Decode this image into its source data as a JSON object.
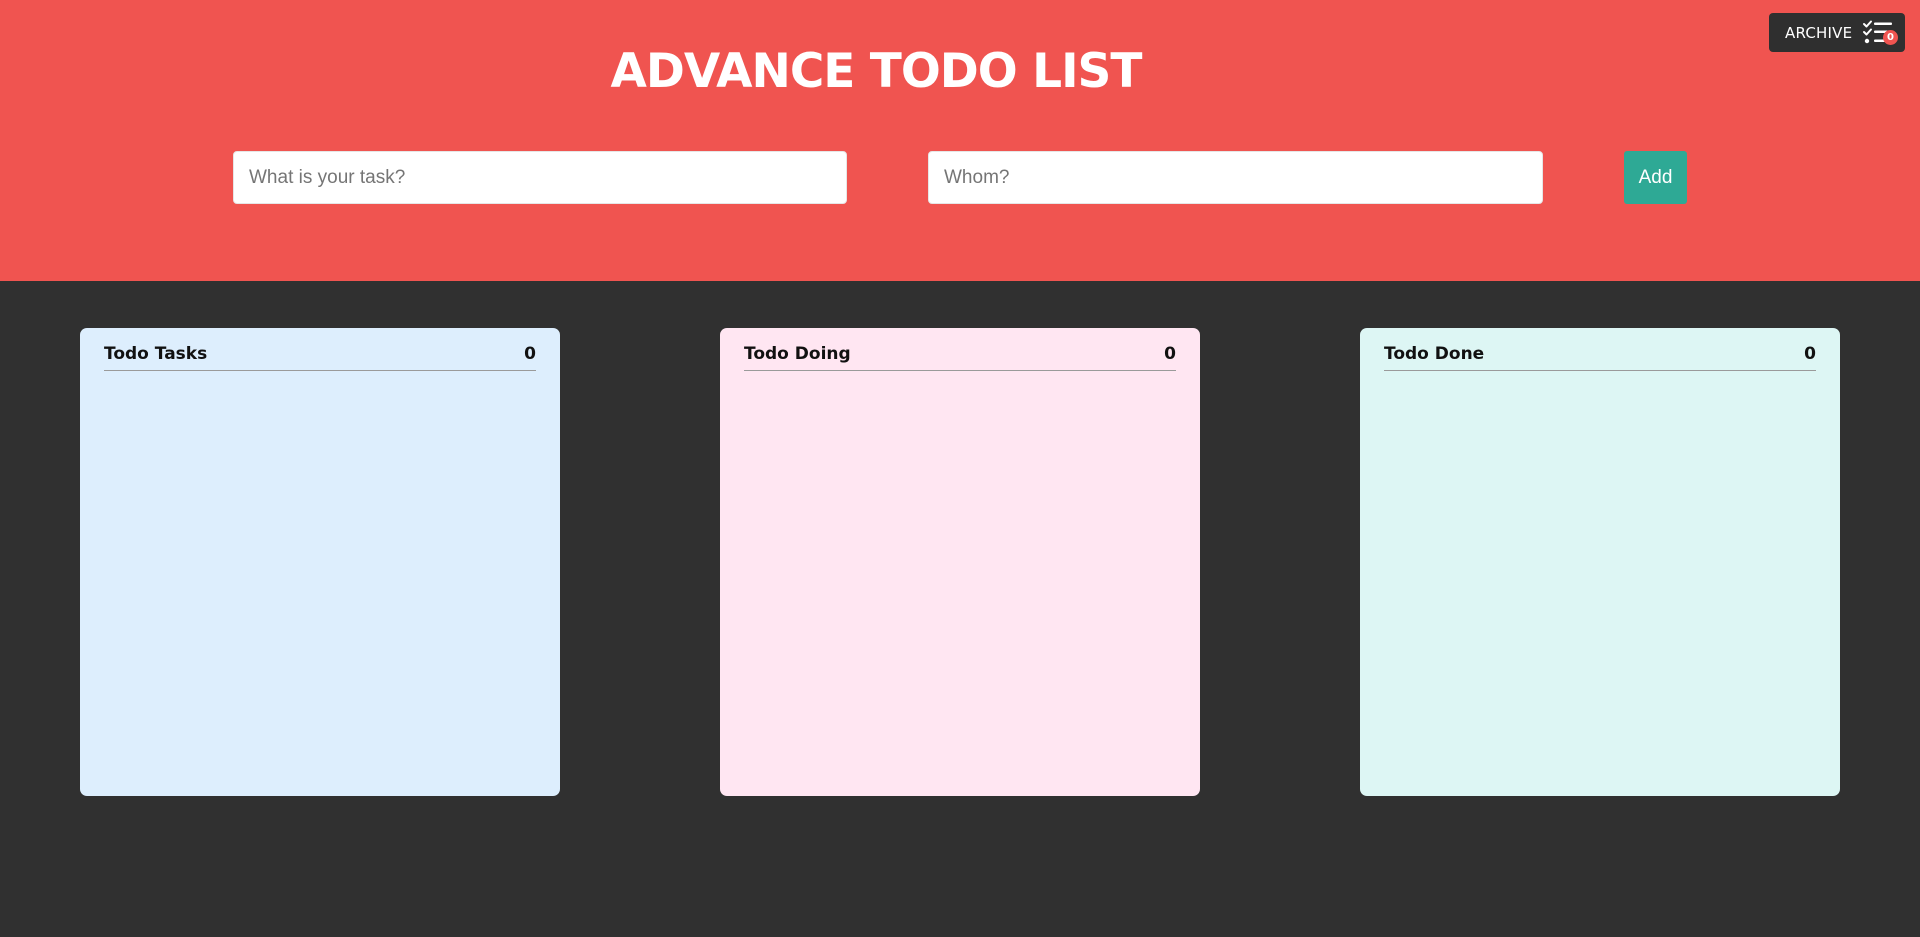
{
  "header": {
    "title": "ADVANCE TODO LIST",
    "background_color": "#f05450"
  },
  "form": {
    "task_placeholder": "What is your task?",
    "task_value": "",
    "whom_placeholder": "Whom?",
    "whom_value": "",
    "add_label": "Add",
    "add_color": "#2ea995"
  },
  "archive": {
    "label": "ARCHIVE",
    "icon": "checklist-icon",
    "count": "0",
    "badge_color": "#f05450"
  },
  "columns": [
    {
      "title": "Todo Tasks",
      "count": "0",
      "color": "#ddeefd",
      "items": []
    },
    {
      "title": "Todo Doing",
      "count": "0",
      "color": "#ffe6f2",
      "items": []
    },
    {
      "title": "Todo Done",
      "count": "0",
      "color": "#ddf6f4",
      "items": []
    }
  ]
}
